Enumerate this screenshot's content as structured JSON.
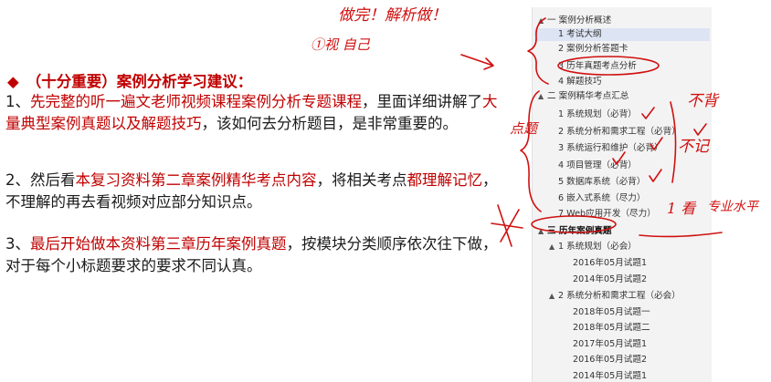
{
  "lesson": {
    "title": "（十分重要）案例分析学习建议：",
    "p1": {
      "prefix": "1、",
      "red1": "先完整的听一遍文老师视频课程案例分析专题课程",
      "mid1": "，里面详细讲解了",
      "red2": "大量典型案例真题以及解题技巧",
      "tail": "，该如何去分析题目，是非常重要的。"
    },
    "p2": {
      "prefix": "2、然后看",
      "red1": "本复习资料第二章案例精华考点内容",
      "mid1": "，将相关考点",
      "red2": "都理解记忆",
      "tail": "，不理解的再去看视频对应部分知识点。"
    },
    "p3": {
      "prefix": "3、",
      "red1": "最后开始做本资料第三章历年案例真题",
      "tail": "，按模块分类顺序依次往下做，对于每个小标题要求的要求不同认真。"
    }
  },
  "nav": {
    "items": [
      {
        "label": "一 案例分析概述",
        "indent": 0,
        "toggle": "▲"
      },
      {
        "label": "1 考试大纲",
        "indent": 1,
        "selected": true
      },
      {
        "label": "2 案例分析答题卡",
        "indent": 1
      },
      {
        "label": "3 历年真题考点分析",
        "indent": 1
      },
      {
        "label": "4 解题技巧",
        "indent": 1
      },
      {
        "label": "二 案例精华考点汇总",
        "indent": 0,
        "toggle": "▲"
      },
      {
        "label": "1 系统规划（必背）",
        "indent": 1
      },
      {
        "label": "2 系统分析和需求工程（必背）",
        "indent": 1
      },
      {
        "label": "3 系统运行和维护（必背）",
        "indent": 1
      },
      {
        "label": "4 项目管理（必背）",
        "indent": 1
      },
      {
        "label": "5 数据库系统（必背）",
        "indent": 1
      },
      {
        "label": "6 嵌入式系统（尽力）",
        "indent": 1
      },
      {
        "label": "7 Web应用开发（尽力）",
        "indent": 1
      },
      {
        "label": "三 历年案例真题",
        "indent": 0,
        "toggle": "▲",
        "dark": true
      },
      {
        "label": "1 系统规划（必会）",
        "indent": 1,
        "toggle": "▲"
      },
      {
        "label": "2016年05月试题1",
        "indent": 2
      },
      {
        "label": "2014年05月试题2",
        "indent": 2
      },
      {
        "label": "2 系统分析和需求工程（必会）",
        "indent": 1,
        "toggle": "▲"
      },
      {
        "label": "2018年05月试题一",
        "indent": 2
      },
      {
        "label": "2018年05月试题二",
        "indent": 2
      },
      {
        "label": "2017年05月试题1",
        "indent": 2
      },
      {
        "label": "2016年05月试题2",
        "indent": 2
      },
      {
        "label": "2014年05月试题1",
        "indent": 2
      }
    ]
  },
  "annotations": {
    "top_note": "做完！解析做！",
    "note_1": "①视 自己",
    "note_busy": "不背",
    "note_remember": "不记",
    "note_see": "1 看",
    "note_flat": "点题",
    "note_level": "专业水平"
  }
}
